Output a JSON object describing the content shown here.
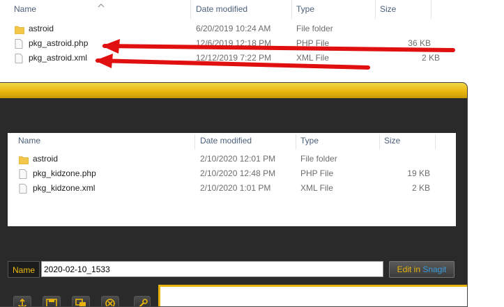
{
  "top": {
    "columns": {
      "name": "Name",
      "date": "Date modified",
      "type": "Type",
      "size": "Size"
    },
    "rows": [
      {
        "name": "astroid",
        "date": "6/20/2019 10:24 AM",
        "type": "File folder",
        "size": "",
        "icon": "folder-icon"
      },
      {
        "name": "pkg_astroid.php",
        "date": "12/6/2019 12:18 PM",
        "type": "PHP File",
        "size": "36 KB",
        "icon": "file-icon"
      },
      {
        "name": "pkg_astroid.xml",
        "date": "12/12/2019 7:22 PM",
        "type": "XML File",
        "size": "2 KB",
        "icon": "file-icon"
      }
    ]
  },
  "capture": {
    "columns": {
      "name": "Name",
      "date": "Date modified",
      "type": "Type",
      "size": "Size"
    },
    "rows": [
      {
        "name": "astroid",
        "date": "2/10/2020 12:01 PM",
        "type": "File folder",
        "size": "",
        "icon": "folder-icon"
      },
      {
        "name": "pkg_kidzone.php",
        "date": "2/10/2020 12:48 PM",
        "type": "PHP File",
        "size": "19 KB",
        "icon": "file-icon"
      },
      {
        "name": "pkg_kidzone.xml",
        "date": "2/10/2020 1:01 PM",
        "type": "XML File",
        "size": "2 KB",
        "icon": "file-icon"
      }
    ]
  },
  "snagit": {
    "name_label": "Name",
    "name_value": "2020-02-10_1533",
    "edit_label_prefix": "Edit in ",
    "edit_label_brand": "Snagit",
    "toolbar": [
      "share-icon",
      "save-icon",
      "copy-icon",
      "delete-icon",
      "tools-icon"
    ]
  },
  "colors": {
    "accent": "#e8b40c",
    "arrow": "#e01010",
    "header_text": "#4c607a",
    "folder": "#f3c74a"
  }
}
